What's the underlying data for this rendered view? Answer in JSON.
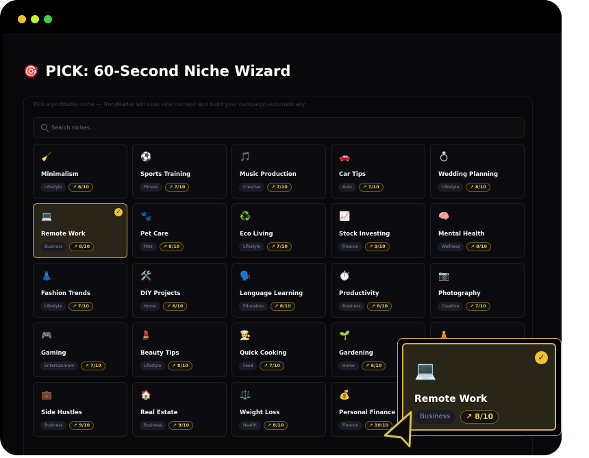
{
  "window": {
    "dots": [
      "#f5bf2c",
      "#c4f02c",
      "#3bd449"
    ]
  },
  "title": {
    "icon": "🎯",
    "text": "PICK: 60-Second Niche Wizard"
  },
  "subtitle": "Pick a profitable niche — TrendRadar will scan viral content and build your campaign automatically.",
  "search": {
    "placeholder": "Search niches..."
  },
  "niches": [
    {
      "emoji": "🧹",
      "name": "Minimalism",
      "category": "Lifestyle",
      "score": "6/10",
      "selected": false
    },
    {
      "emoji": "⚽",
      "name": "Sports Training",
      "category": "Fitness",
      "score": "7/10",
      "selected": false
    },
    {
      "emoji": "🎵",
      "name": "Music Production",
      "category": "Creative",
      "score": "7/10",
      "selected": false
    },
    {
      "emoji": "🚗",
      "name": "Car Tips",
      "category": "Auto",
      "score": "7/10",
      "selected": false
    },
    {
      "emoji": "💍",
      "name": "Wedding Planning",
      "category": "Lifestyle",
      "score": "8/10",
      "selected": false
    },
    {
      "emoji": "💻",
      "name": "Remote Work",
      "category": "Business",
      "score": "8/10",
      "selected": true
    },
    {
      "emoji": "🐾",
      "name": "Pet Care",
      "category": "Pets",
      "score": "8/10",
      "selected": false
    },
    {
      "emoji": "♻️",
      "name": "Eco Living",
      "category": "Lifestyle",
      "score": "7/10",
      "selected": false
    },
    {
      "emoji": "📈",
      "name": "Stock Investing",
      "category": "Finance",
      "score": "9/10",
      "selected": false
    },
    {
      "emoji": "🧠",
      "name": "Mental Health",
      "category": "Wellness",
      "score": "8/10",
      "selected": false
    },
    {
      "emoji": "👗",
      "name": "Fashion Trends",
      "category": "Lifestyle",
      "score": "7/10",
      "selected": false
    },
    {
      "emoji": "🛠️",
      "name": "DIY Projects",
      "category": "Home",
      "score": "6/10",
      "selected": false
    },
    {
      "emoji": "🗣️",
      "name": "Language Learning",
      "category": "Education",
      "score": "8/10",
      "selected": false
    },
    {
      "emoji": "⏱️",
      "name": "Productivity",
      "category": "Business",
      "score": "8/10",
      "selected": false
    },
    {
      "emoji": "📷",
      "name": "Photography",
      "category": "Creative",
      "score": "7/10",
      "selected": false
    },
    {
      "emoji": "🎮",
      "name": "Gaming",
      "category": "Entertainment",
      "score": "7/10",
      "selected": false
    },
    {
      "emoji": "💄",
      "name": "Beauty Tips",
      "category": "Lifestyle",
      "score": "8/10",
      "selected": false
    },
    {
      "emoji": "👨‍🍳",
      "name": "Quick Cooking",
      "category": "Food",
      "score": "7/10",
      "selected": false
    },
    {
      "emoji": "🌱",
      "name": "Gardening",
      "category": "Home",
      "score": "6/10",
      "selected": false
    },
    {
      "emoji": "🧘",
      "name": "",
      "category": "",
      "score": "",
      "selected": false
    },
    {
      "emoji": "💼",
      "name": "Side Hustles",
      "category": "Business",
      "score": "9/10",
      "selected": false
    },
    {
      "emoji": "🏠",
      "name": "Real Estate",
      "category": "Business",
      "score": "9/10",
      "selected": false
    },
    {
      "emoji": "⚖️",
      "name": "Weight Loss",
      "category": "Health",
      "score": "8/10",
      "selected": false
    },
    {
      "emoji": "💰",
      "name": "Personal Finance",
      "category": "Finance",
      "score": "10/10",
      "selected": false
    },
    {
      "emoji": "",
      "name": "",
      "category": "",
      "score": "",
      "selected": false
    }
  ],
  "zoom": {
    "emoji": "💻",
    "name": "Remote Work",
    "category": "Business",
    "score": "8/10"
  },
  "colors": {
    "accent": "#f2c22e",
    "selected_border": "#c9a83d",
    "score_text": "#e4c766"
  }
}
